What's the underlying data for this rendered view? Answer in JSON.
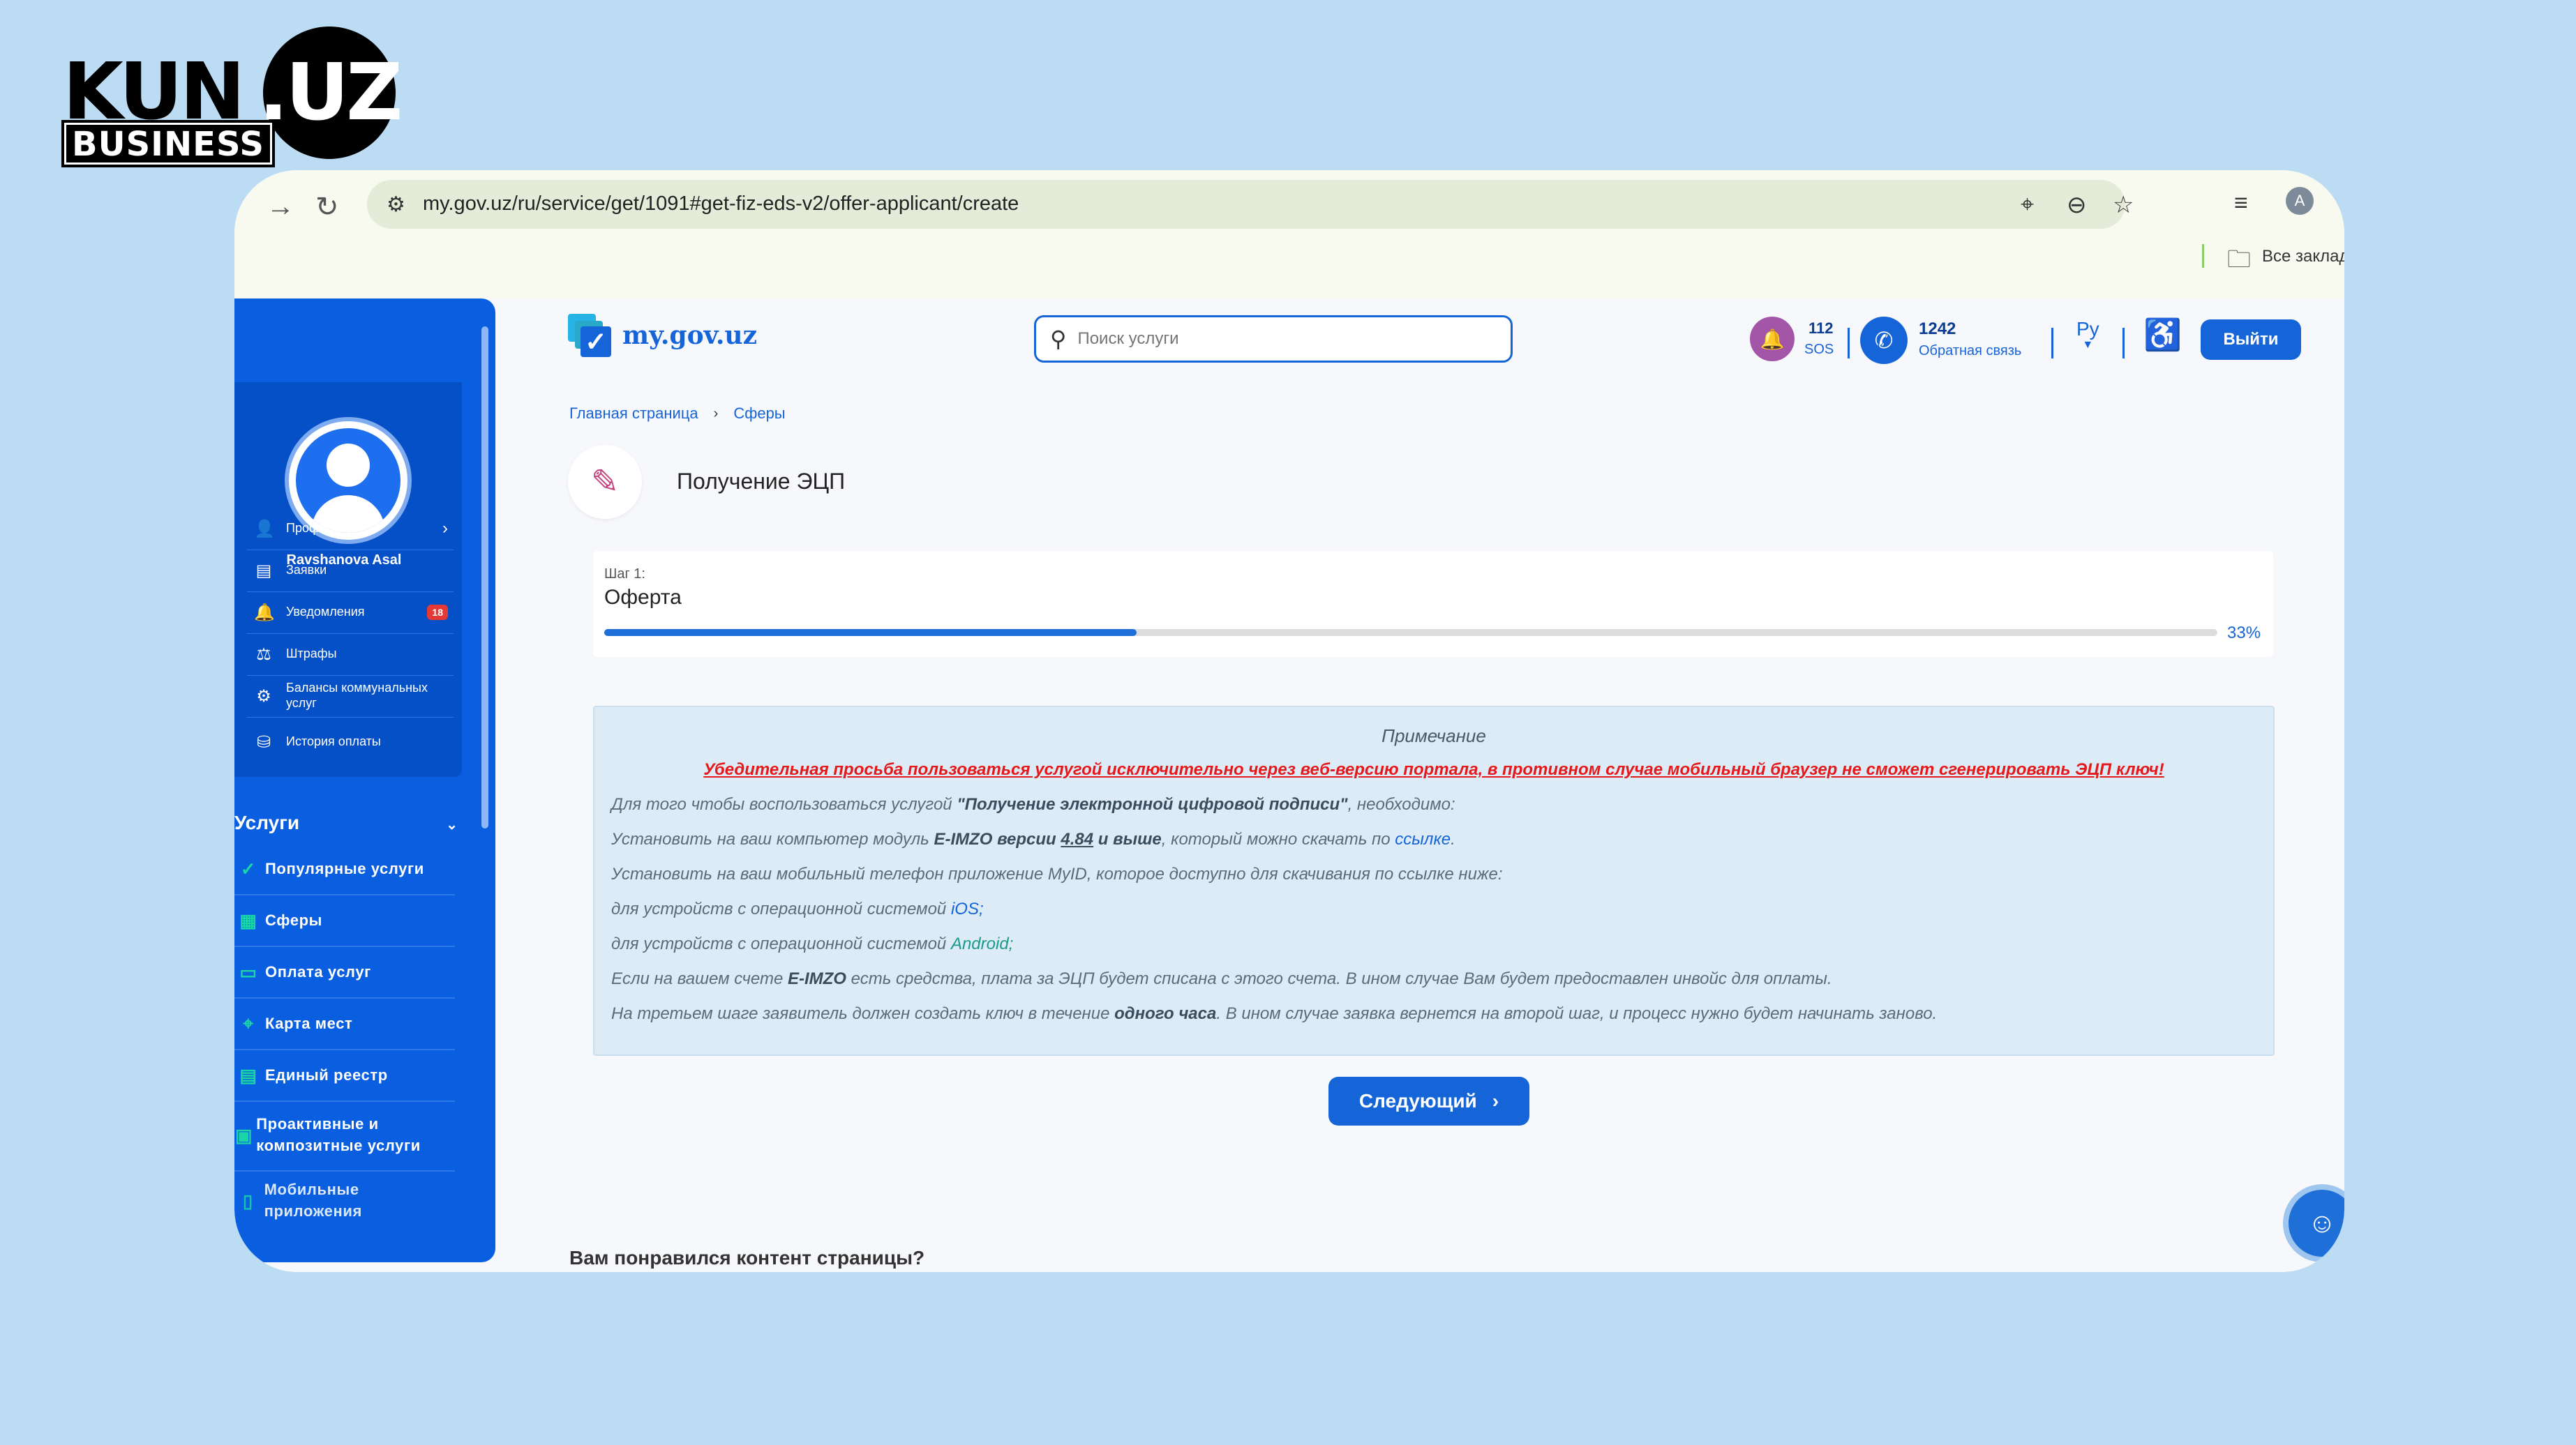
{
  "watermark": {
    "brand": "KUN",
    "brand_suffix": ".UZ",
    "sub": "BUSINESS"
  },
  "browser": {
    "url": "my.gov.uz/ru/service/get/1091#get-fiz-eds-v2/offer-applicant/create",
    "bookmarks_label": "Все заклад"
  },
  "sidebar": {
    "user_name": "Ravshanova Asal",
    "menu": [
      {
        "label": "Профиль",
        "icon": "person-icon",
        "glyph": "👤",
        "has_chevron": true
      },
      {
        "label": "Заявки",
        "icon": "document-icon",
        "glyph": "▤"
      },
      {
        "label": "Уведомления",
        "icon": "bell-icon",
        "glyph": "🔔",
        "badge": "18"
      },
      {
        "label": "Штрафы",
        "icon": "fine-icon",
        "glyph": "⚖"
      },
      {
        "label": "Балансы коммунальных услуг",
        "icon": "utility-icon",
        "glyph": "⚙"
      },
      {
        "label": "История оплаты",
        "icon": "wallet-icon",
        "glyph": "⛁"
      }
    ],
    "services_title": "Услуги",
    "services": [
      {
        "label": "Популярные услуги",
        "icon": "shield-check-icon",
        "glyph": "✓"
      },
      {
        "label": "Сферы",
        "icon": "grid-icon",
        "glyph": "▦"
      },
      {
        "label": "Оплата услуг",
        "icon": "card-icon",
        "glyph": "▭"
      },
      {
        "label": "Карта мест",
        "icon": "map-pin-icon",
        "glyph": "⌖"
      },
      {
        "label": "Единый реестр",
        "icon": "registry-icon",
        "glyph": "▤"
      },
      {
        "label": "Проактивные и композитные услуги",
        "icon": "doc-settings-icon",
        "glyph": "▣"
      },
      {
        "label": "Мобильные приложения",
        "icon": "phone-icon",
        "glyph": "▯"
      }
    ]
  },
  "header": {
    "logo_text": "my.gov.uz",
    "search_placeholder": "Поиск услуги",
    "sos_number": "112",
    "sos_label": "SOS",
    "call_number": "1242",
    "call_label": "Обратная связь",
    "lang": "Ру",
    "logout_label": "Выйти"
  },
  "breadcrumb": [
    "Главная страница",
    "Сферы"
  ],
  "page_title": "Получение ЭЦП",
  "step": {
    "step_label": "Шаг 1:",
    "name": "Оферта",
    "progress": 33,
    "progress_text": "33%"
  },
  "note": {
    "title": "Примечание",
    "warning": "Убедительная просьба пользоваться услугой исключительно через веб-версию портала, в противном случае мобильный браузер не сможет сгенерировать ЭЦП ключ!",
    "l1_a": "Для того чтобы воспользоваться услугой ",
    "l1_b": "\"Получение электронной цифровой подписи\"",
    "l1_c": ", необходимо:",
    "l2_a": "Установить на ваш компьютер модуль ",
    "l2_b": "E-IMZO версии ",
    "l2_c": "4.84",
    "l2_d": " и выше",
    "l2_e": ", который можно скачать по ",
    "l2_f": "ссылке",
    "l2_g": ".",
    "l3": "Установить на ваш мобильный телефон приложение MyID, которое доступно для скачивания по ссылке ниже:",
    "l4_a": "для устройств с операционной системой ",
    "l4_b": "iOS;",
    "l5_a": "для устройств с операционной системой ",
    "l5_b": "Android;",
    "l6_a": "Если на вашем счете ",
    "l6_b": "E-IMZO",
    "l6_c": " есть средства, плата за ЭЦП будет списана с этого счета. В ином случае Вам будет предоставлен инвойс для оплаты.",
    "l7_a": "На третьем шаге заявитель должен создать ключ в течение ",
    "l7_b": "одного часа",
    "l7_c": ". В ином случае заявка вернется на второй шаг, и процесс нужно будет начинать заново."
  },
  "next_button": "Следующий",
  "feedback_question": "Вам понравился контент страницы?",
  "colors": {
    "primary": "#1565d8",
    "sidebar": "#0a5ee0",
    "warning": "#e5191b",
    "note_bg": "#dcebf6",
    "page_bg": "#bcdcf3"
  }
}
